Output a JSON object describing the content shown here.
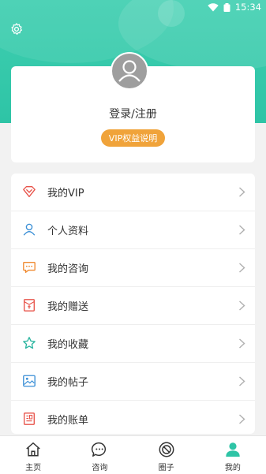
{
  "status": {
    "time": "15:34"
  },
  "profile": {
    "login_label": "登录/注册",
    "vip_button": "VIP权益说明"
  },
  "menu": {
    "items": [
      {
        "label": "我的VIP",
        "icon": "diamond-icon"
      },
      {
        "label": "个人资料",
        "icon": "person-icon"
      },
      {
        "label": "我的咨询",
        "icon": "chat-bubble-icon"
      },
      {
        "label": "我的赠送",
        "icon": "gift-envelope-icon"
      },
      {
        "label": "我的收藏",
        "icon": "star-icon"
      },
      {
        "label": "我的帖子",
        "icon": "image-post-icon"
      },
      {
        "label": "我的账单",
        "icon": "bill-icon"
      }
    ]
  },
  "tabbar": {
    "tabs": [
      {
        "label": "主页",
        "icon": "home-icon"
      },
      {
        "label": "咨询",
        "icon": "chat-icon"
      },
      {
        "label": "圈子",
        "icon": "circle-icon"
      },
      {
        "label": "我的",
        "icon": "profile-icon"
      }
    ],
    "active_index": 3
  },
  "colors": {
    "brand": "#2ec4a6",
    "vip_orange": "#f0a33a"
  }
}
